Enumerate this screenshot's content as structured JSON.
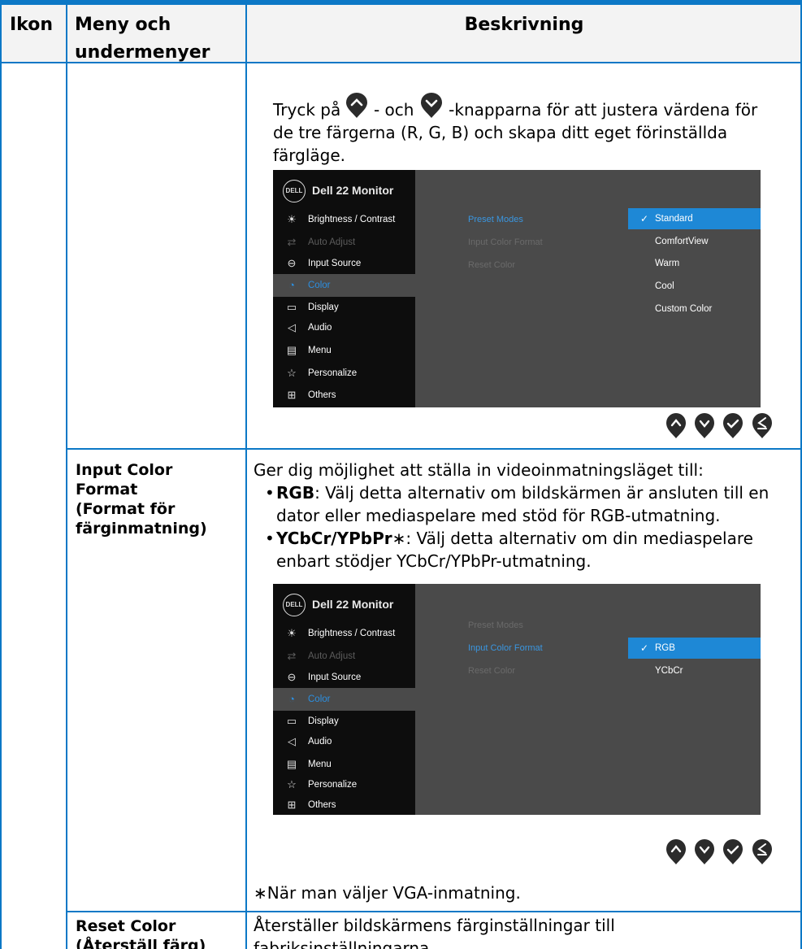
{
  "header": {
    "col1": "Ikon",
    "col2_line1": "Meny och",
    "col2_line2": "undermenyer",
    "col3": "Beskrivning"
  },
  "row1": {
    "text_1": "Tryck på ",
    "text_2": " - och ",
    "text_3": " -knapparna för att justera värdena för",
    "text_4": "de tre färgerna (R, G, B) och skapa ditt eget förinställda",
    "text_5": "färgläge."
  },
  "osd1": {
    "logo": "DELL",
    "title": "Dell 22 Monitor",
    "menu": [
      {
        "icon": "brightness-icon",
        "glyph": "☀",
        "label": "Brightness / Contrast",
        "state": "normal"
      },
      {
        "icon": "auto-adjust-icon",
        "glyph": "⇄",
        "label": "Auto Adjust",
        "state": "dim"
      },
      {
        "icon": "input-source-icon",
        "glyph": "⊖",
        "label": "Input Source",
        "state": "normal"
      },
      {
        "icon": "color-icon",
        "glyph": "◔",
        "label": "Color",
        "state": "sel"
      },
      {
        "icon": "display-icon",
        "glyph": "▭",
        "label": "Display",
        "state": "normal"
      },
      {
        "icon": "audio-icon",
        "glyph": "◁",
        "label": "Audio",
        "state": "normal"
      },
      {
        "icon": "menu-icon",
        "glyph": "▤",
        "label": "Menu",
        "state": "normal"
      },
      {
        "icon": "star-icon",
        "glyph": "☆",
        "label": "Personalize",
        "state": "normal"
      },
      {
        "icon": "others-icon",
        "glyph": "⊞",
        "label": "Others",
        "state": "normal"
      }
    ],
    "submenu": [
      {
        "label": "Preset Modes",
        "active": true
      },
      {
        "label": "Input Color Format",
        "active": false
      },
      {
        "label": "Reset Color",
        "active": false
      }
    ],
    "options": [
      "Standard",
      "ComfortView",
      "Warm",
      "Cool",
      "Custom Color"
    ],
    "selected_option": "Standard"
  },
  "row2": {
    "menu_1": "Input Color",
    "menu_2": "Format",
    "menu_3": "(Format för",
    "menu_4": "färginmatning)",
    "desc_intro": "Ger dig möjlighet att ställa in videoinmatningsläget till:",
    "rgb_term": "RGB",
    "rgb_text_1": ": Välj detta alternativ om bildskärmen är ansluten till en",
    "rgb_text_2": "dator eller mediaspelare med stöd för RGB-utmatning.",
    "ycbcr_term": "YCbCr/YPbPr",
    "ycbcr_star": "∗",
    "ycbcr_text_1": ": Välj detta alternativ om din mediaspelare",
    "ycbcr_text_2": "enbart stödjer YCbCr/YPbPr-utmatning.",
    "footnote": "∗När man väljer VGA-inmatning."
  },
  "osd2": {
    "logo": "DELL",
    "title": "Dell 22 Monitor",
    "submenu": [
      {
        "label": "Preset Modes",
        "active": false
      },
      {
        "label": "Input Color Format",
        "active": true
      },
      {
        "label": "Reset Color",
        "active": false
      }
    ],
    "options": [
      "RGB",
      "YCbCr"
    ],
    "selected_option": "RGB"
  },
  "row3": {
    "menu_1": "Reset Color",
    "menu_2": "(Återställ färg)",
    "desc_1": "Återställer bildskärmens färginställningar till",
    "desc_2": "fabriksinställningarna."
  },
  "buttons": [
    "up-button",
    "down-button",
    "ok-button",
    "back-button"
  ],
  "colors": {
    "accent": "#0c78c6",
    "osd_bg": "#4a4a4a",
    "osd_menu_bg": "#0d0d0d",
    "osd_selected": "#1e88d6",
    "header_bg": "#f3f3f3"
  }
}
